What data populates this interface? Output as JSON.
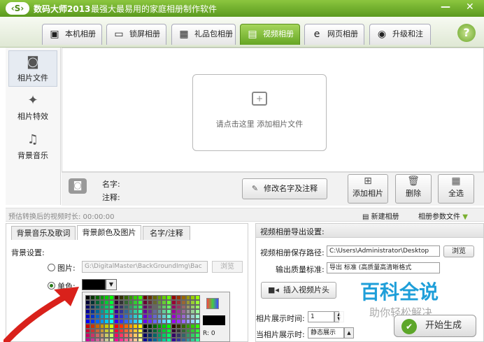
{
  "titlebar": {
    "logo": "‹S›",
    "app_name": "数码大师2013",
    "slogan": "最强大最易用的家庭相册制作软件",
    "minimize": "—",
    "close": "✕"
  },
  "tabs": [
    {
      "label": "本机相册",
      "icon": "user-card-icon",
      "glyph": "▣"
    },
    {
      "label": "锁屏相册",
      "icon": "monitor-icon",
      "glyph": "▭"
    },
    {
      "label": "礼品包相册",
      "icon": "gift-icon",
      "glyph": "▦"
    },
    {
      "label": "视频相册",
      "icon": "film-icon",
      "glyph": "▤"
    },
    {
      "label": "网页相册",
      "icon": "ie-icon",
      "glyph": "e"
    },
    {
      "label": "升级和注册",
      "icon": "globe-icon",
      "glyph": "◉"
    }
  ],
  "help": "?",
  "sidebar": {
    "items": [
      {
        "label": "相片文件",
        "icon": "camera-icon",
        "glyph": "◙"
      },
      {
        "label": "相片特效",
        "icon": "effects-icon",
        "glyph": "✦"
      },
      {
        "label": "背景音乐",
        "icon": "music-icon",
        "glyph": "♫"
      }
    ]
  },
  "dropzone": {
    "text": "请点击这里 添加相片文件",
    "icon_glyph": "+"
  },
  "photo_info": {
    "name_label": "名字:",
    "note_label": "注释:",
    "cam_glyph": "◙"
  },
  "buttons": {
    "edit_name": "修改名字及注释",
    "edit_glyph": "✎",
    "add_photo": "添加相片",
    "add_glyph": "⊞",
    "delete": "删除",
    "delete_glyph": "🗑",
    "select_all": "全选",
    "select_glyph": "▦"
  },
  "status": {
    "estimate": "预估转换后的视频时长: 00:00:00",
    "new_album": "新建相册",
    "album_params": "相册参数文件"
  },
  "bottom_tabs": [
    "背景音乐及歌词",
    "背景颜色及图片",
    "名字/注释"
  ],
  "bg_settings": {
    "title": "背景设置:",
    "image_label": "图片:",
    "image_path": "G:\\DigitalMaster\\BackGroundImg\\Bac",
    "browse": "浏览",
    "solid_label": "单色:",
    "rgb": "R: 0"
  },
  "export": {
    "header": "视频相册导出设置:",
    "save_path_label": "视频相册保存路径:",
    "save_path": "C:\\Users\\Administrator\\Desktop",
    "browse": "浏览",
    "quality_label": "输出质量标准:",
    "quality_value": "导出 标准 (高质量高清晰格式",
    "insert_header": "插入视频片头",
    "display_time_label": "相片展示时间:",
    "display_time": "1",
    "current_display_label": "当相片展示时:",
    "current_display": "静态展示",
    "start": "开始生成"
  },
  "watermark": {
    "main": "百科全说",
    "sub": "助你轻松解决"
  },
  "colors": {
    "accent": "#5a9a1e",
    "tab_active": "#66a624",
    "arrow": "#d9211b"
  }
}
